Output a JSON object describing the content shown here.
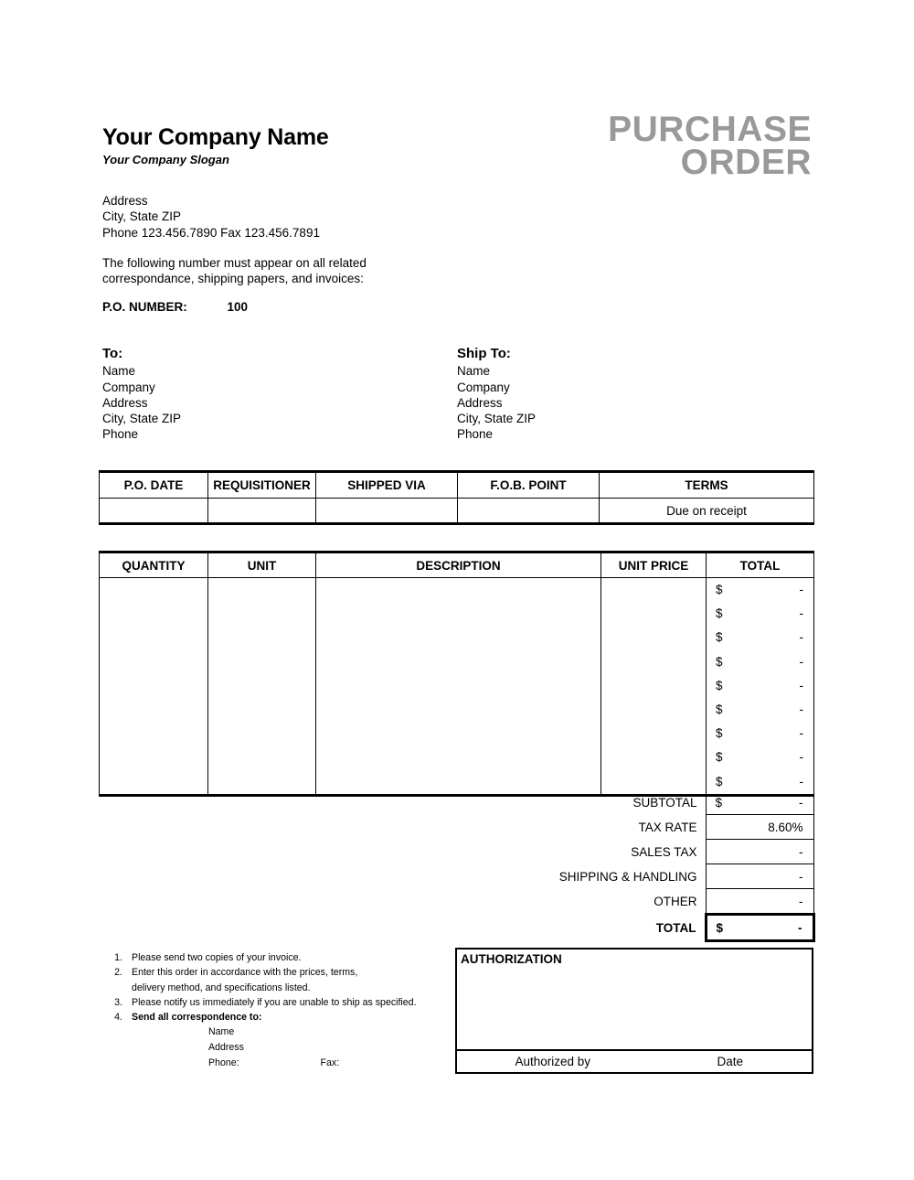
{
  "header": {
    "company_name": "Your Company Name",
    "company_slogan": "Your Company Slogan",
    "title_line1": "PURCHASE",
    "title_line2": "ORDER",
    "title_color": "#999999",
    "address_line1": "Address",
    "address_line2": "City, State ZIP",
    "address_line3": "Phone 123.456.7890   Fax 123.456.7891",
    "notice_line1": "The following number must appear on all related",
    "notice_line2": "correspondance, shipping papers, and invoices:",
    "po_number_label": "P.O. NUMBER:",
    "po_number_value": "100"
  },
  "parties": {
    "to": {
      "heading": "To:",
      "lines": [
        "Name",
        "Company",
        "Address",
        "City, State ZIP",
        "Phone"
      ]
    },
    "ship_to": {
      "heading": "Ship To:",
      "lines": [
        "Name",
        "Company",
        "Address",
        "City, State  ZIP",
        "Phone"
      ]
    }
  },
  "info_table": {
    "headers": [
      "P.O. DATE",
      "REQUISITIONER",
      "SHIPPED VIA",
      "F.O.B. POINT",
      "TERMS"
    ],
    "values": [
      "",
      "",
      "",
      "",
      "Due on receipt"
    ]
  },
  "items_table": {
    "headers": [
      "QUANTITY",
      "UNIT",
      "DESCRIPTION",
      "UNIT PRICE",
      "TOTAL"
    ],
    "rows": [
      {
        "quantity": "",
        "unit": "",
        "description": "",
        "unit_price": "",
        "currency": "$",
        "total": "-"
      },
      {
        "quantity": "",
        "unit": "",
        "description": "",
        "unit_price": "",
        "currency": "$",
        "total": "-"
      },
      {
        "quantity": "",
        "unit": "",
        "description": "",
        "unit_price": "",
        "currency": "$",
        "total": "-"
      },
      {
        "quantity": "",
        "unit": "",
        "description": "",
        "unit_price": "",
        "currency": "$",
        "total": "-"
      },
      {
        "quantity": "",
        "unit": "",
        "description": "",
        "unit_price": "",
        "currency": "$",
        "total": "-"
      },
      {
        "quantity": "",
        "unit": "",
        "description": "",
        "unit_price": "",
        "currency": "$",
        "total": "-"
      },
      {
        "quantity": "",
        "unit": "",
        "description": "",
        "unit_price": "",
        "currency": "$",
        "total": "-"
      },
      {
        "quantity": "",
        "unit": "",
        "description": "",
        "unit_price": "",
        "currency": "$",
        "total": "-"
      },
      {
        "quantity": "",
        "unit": "",
        "description": "",
        "unit_price": "",
        "currency": "$",
        "total": "-"
      }
    ]
  },
  "totals": {
    "subtotal_label": "SUBTOTAL",
    "subtotal_currency": "$",
    "subtotal_value": "-",
    "tax_rate_label": "TAX RATE",
    "tax_rate_currency": "",
    "tax_rate_value": "8.60%",
    "sales_tax_label": "SALES TAX",
    "sales_tax_currency": "",
    "sales_tax_value": "-",
    "shipping_label": "SHIPPING & HANDLING",
    "shipping_currency": "",
    "shipping_value": "-",
    "other_label": "OTHER",
    "other_currency": "",
    "other_value": "-",
    "total_label": "TOTAL",
    "total_currency": "$",
    "total_value": "-"
  },
  "notes": {
    "items": [
      {
        "num": "1.",
        "text": "Please send two copies of your invoice."
      },
      {
        "num": "2.",
        "text": "Enter this order in accordance with the prices, terms,"
      },
      {
        "num": "3.",
        "text": "Please notify us immediately if you are unable to ship as specified."
      },
      {
        "num": "4.",
        "text": "Send all correspondence to:"
      }
    ],
    "item2_continuation": "delivery method, and specifications listed.",
    "correspondence_name": "Name",
    "correspondence_address": "Address",
    "correspondence_phone": "Phone:",
    "correspondence_fax": "Fax:"
  },
  "authorization": {
    "title": "AUTHORIZATION",
    "authorized_by": "Authorized by",
    "date": "Date"
  }
}
